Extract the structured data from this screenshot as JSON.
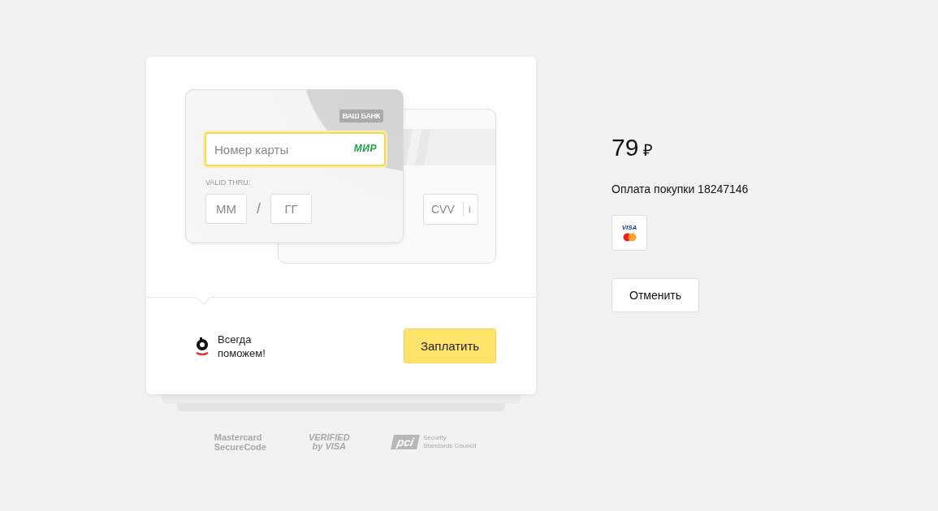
{
  "payment_form": {
    "bank_label": "ВАШ БАНК",
    "card_number": {
      "placeholder": "Номер карты",
      "brand": "МИР"
    },
    "valid_thru_label": "VALID THRU:",
    "month": {
      "placeholder": "ММ"
    },
    "separator": "/",
    "year": {
      "placeholder": "ГГ"
    },
    "cvv": {
      "placeholder": "CVV",
      "info": "i"
    },
    "support_text": "Всегда поможем!",
    "pay_button": "Заплатить"
  },
  "security_logos": [
    {
      "kind": "mastercard",
      "lines": [
        "Mastercard",
        "SecureCode"
      ]
    },
    {
      "kind": "visa",
      "lines": [
        "VERIFIED",
        "by VISA"
      ]
    },
    {
      "kind": "pci",
      "badge": "pci",
      "lines": [
        "Security",
        "Standards Council"
      ]
    }
  ],
  "order": {
    "amount": "79",
    "currency": "₽",
    "description": "Оплата покупки 18247146",
    "accepted_card_label": "VISA",
    "cancel_button": "Отменить"
  }
}
